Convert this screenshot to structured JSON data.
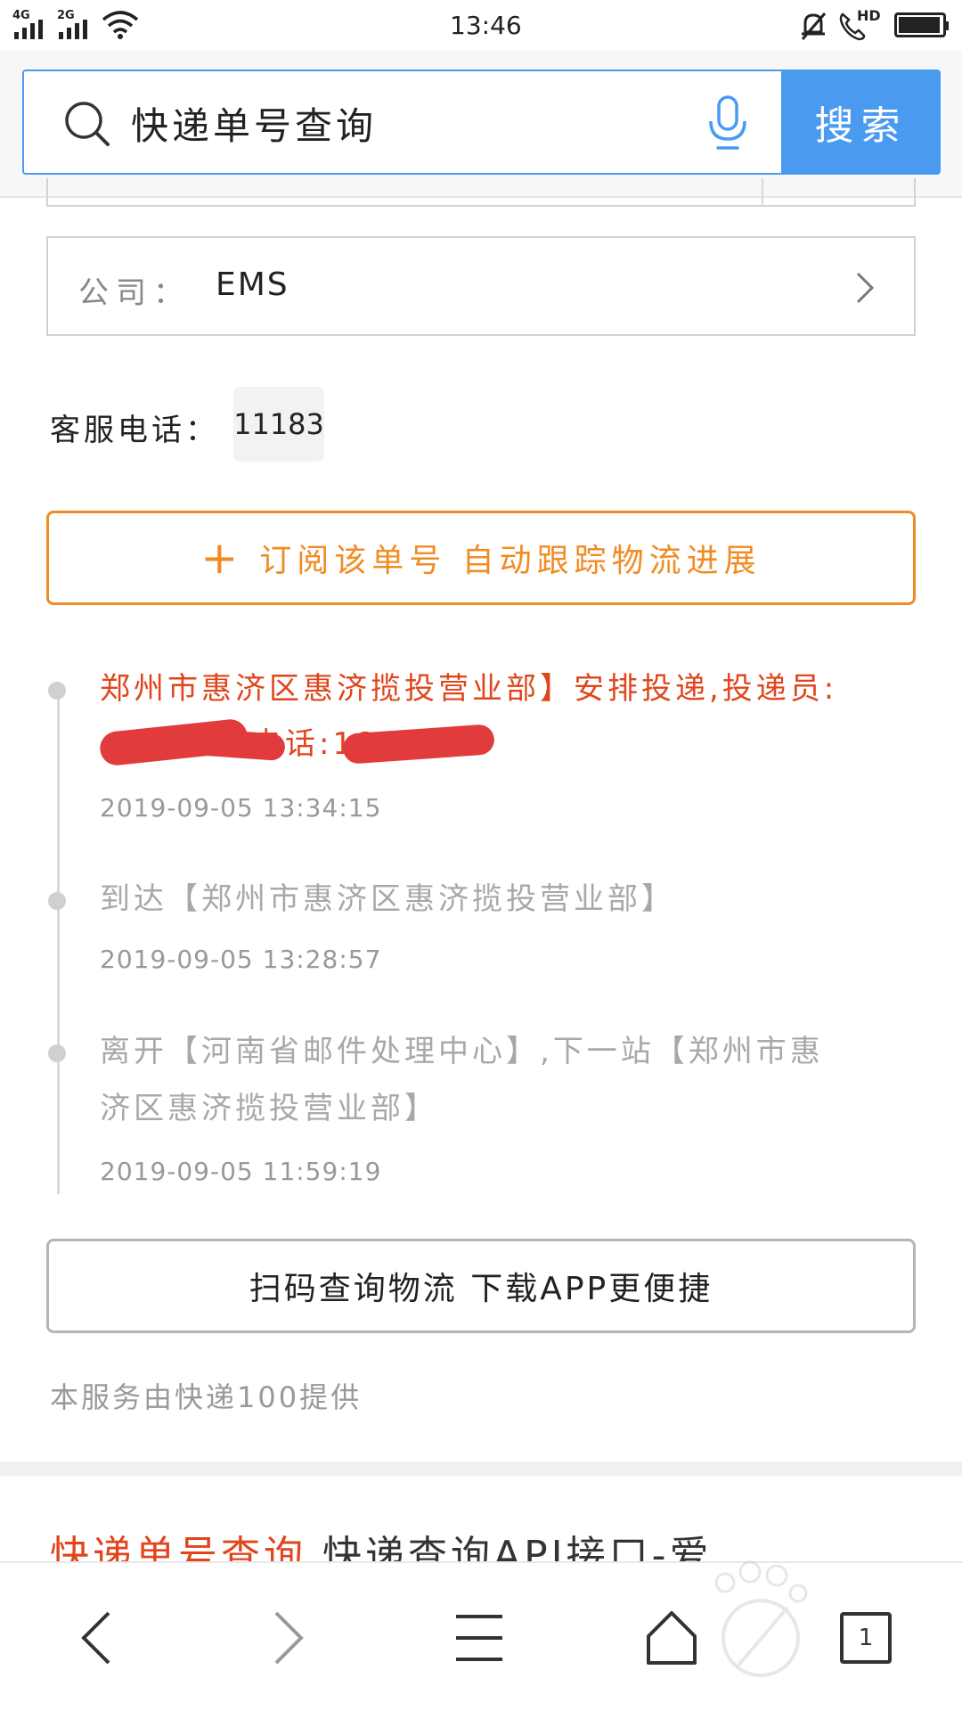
{
  "status_bar": {
    "signal1": "4G",
    "signal2": "2G",
    "time": "13:46",
    "hd": "HD"
  },
  "search": {
    "query": "快递单号查询",
    "button_label": "搜索"
  },
  "company": {
    "label": "公司：",
    "value": "EMS"
  },
  "service_phone": {
    "label": "客服电话：",
    "number": "11183"
  },
  "subscribe_button": {
    "plus": "+",
    "label": "订阅该单号 自动跟踪物流进展"
  },
  "timeline": [
    {
      "line1": "郑州市惠济区惠济揽投营业部】安排投递,投递员:",
      "line2_visible": "电话:1853",
      "time": "2019-09-05 13:34:15"
    },
    {
      "line1": "到达【郑州市惠济区惠济揽投营业部】",
      "time": "2019-09-05 13:28:57"
    },
    {
      "line1": "离开【河南省邮件处理中心】,下一站【郑州市惠",
      "line2": "济区惠济揽投营业部】",
      "time": "2019-09-05 11:59:19"
    }
  ],
  "app_button": {
    "label": "扫码查询物流 下载APP更便捷"
  },
  "provider_note": "本服务由快递100提供",
  "result_link": {
    "highlight": "快递单号查询",
    "rest": " 快递查询API接口-爱"
  },
  "bottom_nav": {
    "tab_count": "1"
  },
  "colors": {
    "accent_blue": "#4a9bf0",
    "accent_orange": "#f08c24",
    "active_red": "#e0451b"
  }
}
